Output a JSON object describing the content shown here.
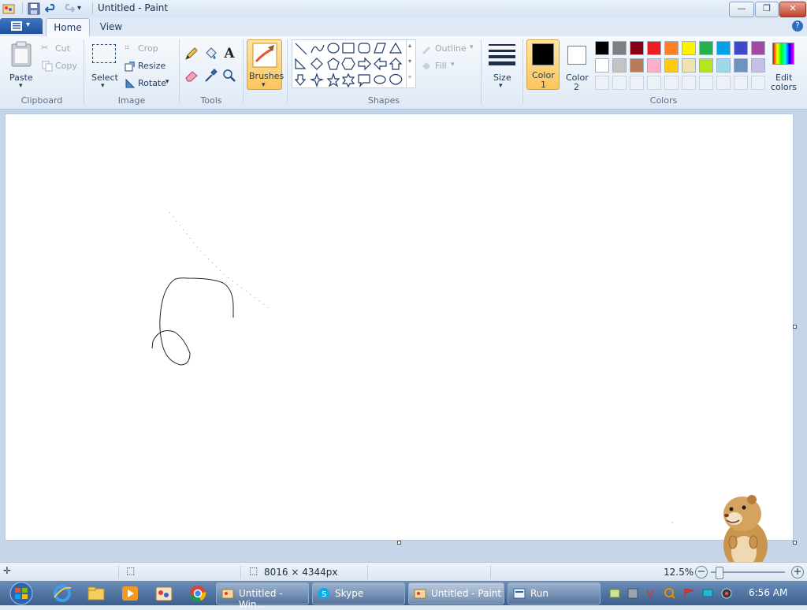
{
  "window": {
    "title": "Untitled - Paint",
    "controls": {
      "minimize": "—",
      "maximize": "❐",
      "close": "✕"
    }
  },
  "tabs": {
    "home": "Home",
    "view": "View"
  },
  "ribbon": {
    "clipboard": {
      "paste": "Paste",
      "cut": "Cut",
      "copy": "Copy",
      "group": "Clipboard"
    },
    "image": {
      "select": "Select",
      "crop": "Crop",
      "resize": "Resize",
      "rotate": "Rotate",
      "group": "Image"
    },
    "tools": {
      "group": "Tools"
    },
    "brushes": {
      "label": "Brushes"
    },
    "shapes": {
      "outline": "Outline",
      "fill": "Fill",
      "group": "Shapes"
    },
    "size": {
      "label": "Size"
    },
    "colors": {
      "color1_line1": "Color",
      "color1_line2": "1",
      "color2_line1": "Color",
      "color2_line2": "2",
      "edit_line1": "Edit",
      "edit_line2": "colors",
      "group": "Colors",
      "palette_row1": [
        "#000000",
        "#7f7f7f",
        "#880015",
        "#ed1c24",
        "#ff7f27",
        "#fff200",
        "#22b14c",
        "#00a2e8",
        "#3f48cc",
        "#a349a4"
      ],
      "palette_row2": [
        "#ffffff",
        "#c3c3c3",
        "#b97a57",
        "#ffaec9",
        "#ffc90e",
        "#efe4b0",
        "#b5e61d",
        "#99d9ea",
        "#7092be",
        "#c8bfe7"
      ],
      "color1": "#000000",
      "color2": "#ffffff"
    }
  },
  "statusbar": {
    "dimensions": "8016 × 4344px",
    "zoom": "12.5%"
  },
  "taskbar": {
    "tasks": [
      {
        "label": "Untitled - Win..."
      },
      {
        "label": "Skype"
      },
      {
        "label": "Untitled - Paint"
      },
      {
        "label": "Run"
      }
    ],
    "clock": "6:56 AM"
  }
}
